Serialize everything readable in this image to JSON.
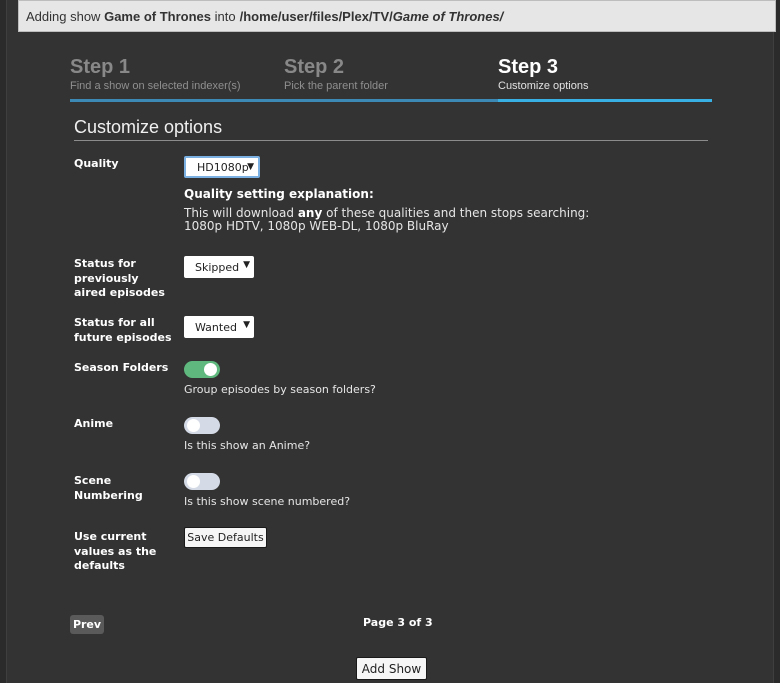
{
  "header": {
    "prefix": "Adding show",
    "show_name": "Game of Thrones",
    "into": "into",
    "path_prefix": "/home/user/files/Plex/TV/",
    "path_italic": "Game of Thrones/"
  },
  "steps": [
    {
      "label": "Step 1",
      "desc": "Find a show on selected indexer(s)"
    },
    {
      "label": "Step 2",
      "desc": "Pick the parent folder"
    },
    {
      "label": "Step 3",
      "desc": "Customize options"
    }
  ],
  "active_step": 3,
  "section_title": "Customize options",
  "quality": {
    "label": "Quality",
    "selected": "HD1080p",
    "explanation_title": "Quality setting explanation:",
    "explanation_pre": "This will download",
    "explanation_bold": "any",
    "explanation_post": "of these qualities and then stops searching:",
    "explanation_line2": "1080p HDTV, 1080p WEB-DL, 1080p BluRay"
  },
  "status_previous": {
    "label": "Status for previously aired episodes",
    "selected": "Skipped"
  },
  "status_future": {
    "label": "Status for all future episodes",
    "selected": "Wanted"
  },
  "season_folders": {
    "label": "Season Folders",
    "enabled": true,
    "helper": "Group episodes by season folders?"
  },
  "anime": {
    "label": "Anime",
    "enabled": false,
    "helper": "Is this show an Anime?"
  },
  "scene_numbering": {
    "label": "Scene Numbering",
    "enabled": false,
    "helper": "Is this show scene numbered?"
  },
  "defaults": {
    "label": "Use current values as the defaults",
    "button": "Save Defaults"
  },
  "nav": {
    "prev": "Prev",
    "page": "Page 3 of 3",
    "add_show": "Add Show"
  },
  "icons": {
    "dropdown_arrow": "caret-down-icon"
  },
  "colors": {
    "toggle_on": "#5fb97e",
    "toggle_off": "#d5dbe6",
    "step_bar": "#3c89b6",
    "step_bar_active": "#39b0e4"
  }
}
